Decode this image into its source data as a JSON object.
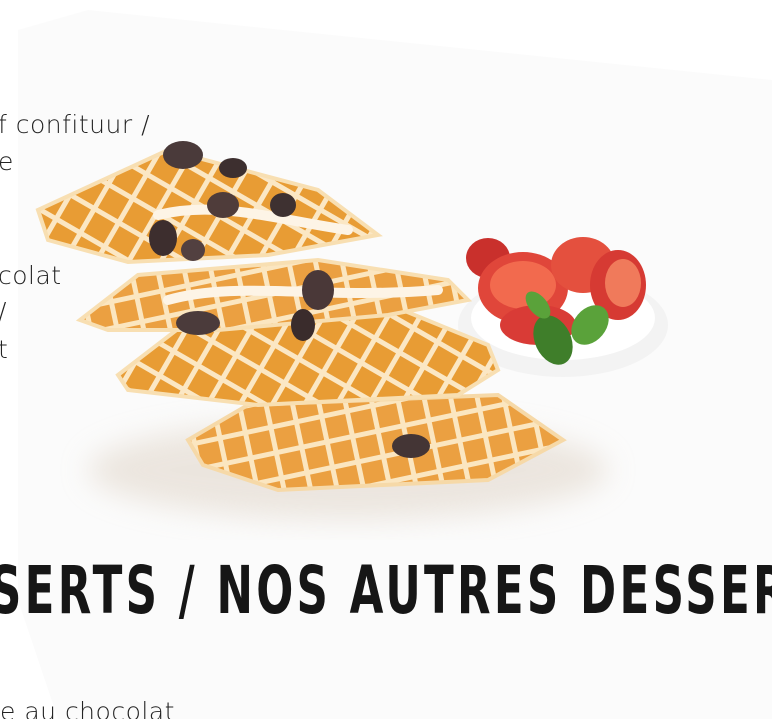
{
  "menu_fragments": [
    "f confituur /",
    "e",
    "colat",
    "/",
    "t",
    "e au chocolat"
  ],
  "section_heading": "SERTS / NOS AUTRES DESSERTS",
  "photo": {
    "subject": "waffles-with-raisins-and-strawberries"
  }
}
